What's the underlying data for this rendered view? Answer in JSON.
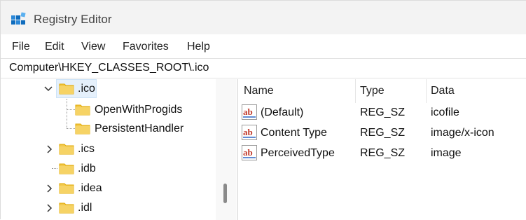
{
  "window": {
    "title": "Registry Editor",
    "icon": "registry-icon"
  },
  "menu": [
    {
      "label": "File"
    },
    {
      "label": "Edit"
    },
    {
      "label": "View"
    },
    {
      "label": "Favorites"
    },
    {
      "label": "Help"
    }
  ],
  "address": {
    "value": "Computer\\HKEY_CLASSES_ROOT\\.ico"
  },
  "tree": {
    "items": [
      {
        "label": ".ico",
        "expanded": true,
        "selected": true,
        "icon": "folder-icon"
      },
      {
        "label": "OpenWithProgids",
        "icon": "folder-icon"
      },
      {
        "label": "PersistentHandler",
        "icon": "folder-icon"
      },
      {
        "label": ".ics",
        "expanded": false,
        "icon": "folder-icon"
      },
      {
        "label": ".idb",
        "icon": "folder-icon"
      },
      {
        "label": ".idea",
        "expanded": false,
        "icon": "folder-icon"
      },
      {
        "label": ".idl",
        "expanded": false,
        "icon": "folder-icon"
      }
    ]
  },
  "list": {
    "columns": [
      "Name",
      "Type",
      "Data"
    ],
    "rows": [
      {
        "name": "(Default)",
        "type": "REG_SZ",
        "data": "icofile",
        "icon": "string-value-icon"
      },
      {
        "name": "Content Type",
        "type": "REG_SZ",
        "data": "image/x-icon",
        "icon": "string-value-icon"
      },
      {
        "name": "PerceivedType",
        "type": "REG_SZ",
        "data": "image",
        "icon": "string-value-icon"
      }
    ]
  },
  "colors": {
    "folder": "#f2c94c",
    "folder_dark": "#e0a800",
    "selection": "#e5f0fb",
    "ab_red": "#c0392b"
  }
}
